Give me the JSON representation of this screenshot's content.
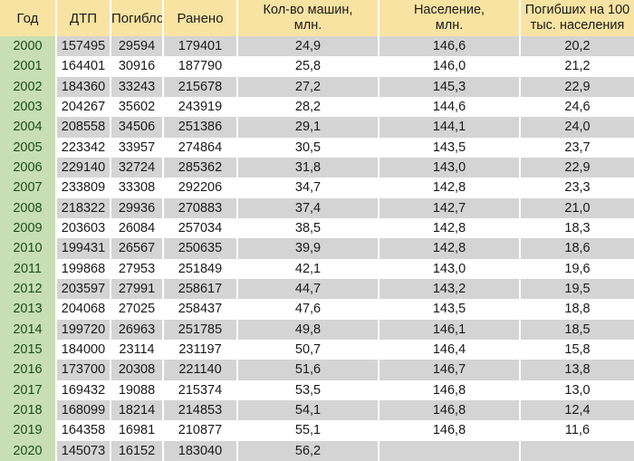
{
  "table": {
    "columns": [
      {
        "key": "year",
        "label": "Год"
      },
      {
        "key": "dtp",
        "label": "ДТП"
      },
      {
        "key": "dead",
        "label": "Погибло"
      },
      {
        "key": "inj",
        "label": "Ранено"
      },
      {
        "key": "cars",
        "label": "Кол-во машин,",
        "label2": "млн."
      },
      {
        "key": "pop",
        "label": "Население,",
        "label2": "млн."
      },
      {
        "key": "rate",
        "label": "Погибших на 100",
        "label2": "тыс. населения"
      }
    ],
    "rows": [
      {
        "year": "2000",
        "dtp": "157495",
        "dead": "29594",
        "inj": "179401",
        "cars": "24,9",
        "pop": "146,6",
        "rate": "20,2"
      },
      {
        "year": "2001",
        "dtp": "164401",
        "dead": "30916",
        "inj": "187790",
        "cars": "25,8",
        "pop": "146,0",
        "rate": "21,2"
      },
      {
        "year": "2002",
        "dtp": "184360",
        "dead": "33243",
        "inj": "215678",
        "cars": "27,2",
        "pop": "145,3",
        "rate": "22,9"
      },
      {
        "year": "2003",
        "dtp": "204267",
        "dead": "35602",
        "inj": "243919",
        "cars": "28,2",
        "pop": "144,6",
        "rate": "24,6"
      },
      {
        "year": "2004",
        "dtp": "208558",
        "dead": "34506",
        "inj": "251386",
        "cars": "29,1",
        "pop": "144,1",
        "rate": "24,0"
      },
      {
        "year": "2005",
        "dtp": "223342",
        "dead": "33957",
        "inj": "274864",
        "cars": "30,5",
        "pop": "143,5",
        "rate": "23,7"
      },
      {
        "year": "2006",
        "dtp": "229140",
        "dead": "32724",
        "inj": "285362",
        "cars": "31,8",
        "pop": "143,0",
        "rate": "22,9"
      },
      {
        "year": "2007",
        "dtp": "233809",
        "dead": "33308",
        "inj": "292206",
        "cars": "34,7",
        "pop": "142,8",
        "rate": "23,3"
      },
      {
        "year": "2008",
        "dtp": "218322",
        "dead": "29936",
        "inj": "270883",
        "cars": "37,4",
        "pop": "142,7",
        "rate": "21,0"
      },
      {
        "year": "2009",
        "dtp": "203603",
        "dead": "26084",
        "inj": "257034",
        "cars": "38,5",
        "pop": "142,8",
        "rate": "18,3"
      },
      {
        "year": "2010",
        "dtp": "199431",
        "dead": "26567",
        "inj": "250635",
        "cars": "39,9",
        "pop": "142,8",
        "rate": "18,6"
      },
      {
        "year": "2011",
        "dtp": "199868",
        "dead": "27953",
        "inj": "251849",
        "cars": "42,1",
        "pop": "143,0",
        "rate": "19,6"
      },
      {
        "year": "2012",
        "dtp": "203597",
        "dead": "27991",
        "inj": "258617",
        "cars": "44,7",
        "pop": "143,2",
        "rate": "19,5"
      },
      {
        "year": "2013",
        "dtp": "204068",
        "dead": "27025",
        "inj": "258437",
        "cars": "47,6",
        "pop": "143,5",
        "rate": "18,8"
      },
      {
        "year": "2014",
        "dtp": "199720",
        "dead": "26963",
        "inj": "251785",
        "cars": "49,8",
        "pop": "146,1",
        "rate": "18,5"
      },
      {
        "year": "2015",
        "dtp": "184000",
        "dead": "23114",
        "inj": "231197",
        "cars": "50,7",
        "pop": "146,4",
        "rate": "15,8"
      },
      {
        "year": "2016",
        "dtp": "173700",
        "dead": "20308",
        "inj": "221140",
        "cars": "51,6",
        "pop": "146,7",
        "rate": "13,8"
      },
      {
        "year": "2017",
        "dtp": "169432",
        "dead": "19088",
        "inj": "215374",
        "cars": "53,5",
        "pop": "146,8",
        "rate": "13,0"
      },
      {
        "year": "2018",
        "dtp": "168099",
        "dead": "18214",
        "inj": "214853",
        "cars": "54,1",
        "pop": "146,8",
        "rate": "12,4"
      },
      {
        "year": "2019",
        "dtp": "164358",
        "dead": "16981",
        "inj": "210877",
        "cars": "55,1",
        "pop": "146,8",
        "rate": "11,6"
      },
      {
        "year": "2020",
        "dtp": "145073",
        "dead": "16152",
        "inj": "183040",
        "cars": "56,2",
        "pop": "",
        "rate": ""
      }
    ]
  },
  "colors": {
    "header_bg": "#f9e3a2",
    "year_bg": "#c7dfb2",
    "year_text": "#1e4d1e",
    "row_odd_bg": "#d4d4d4",
    "row_even_bg": "#ffffff",
    "text": "#1a1a1a"
  }
}
